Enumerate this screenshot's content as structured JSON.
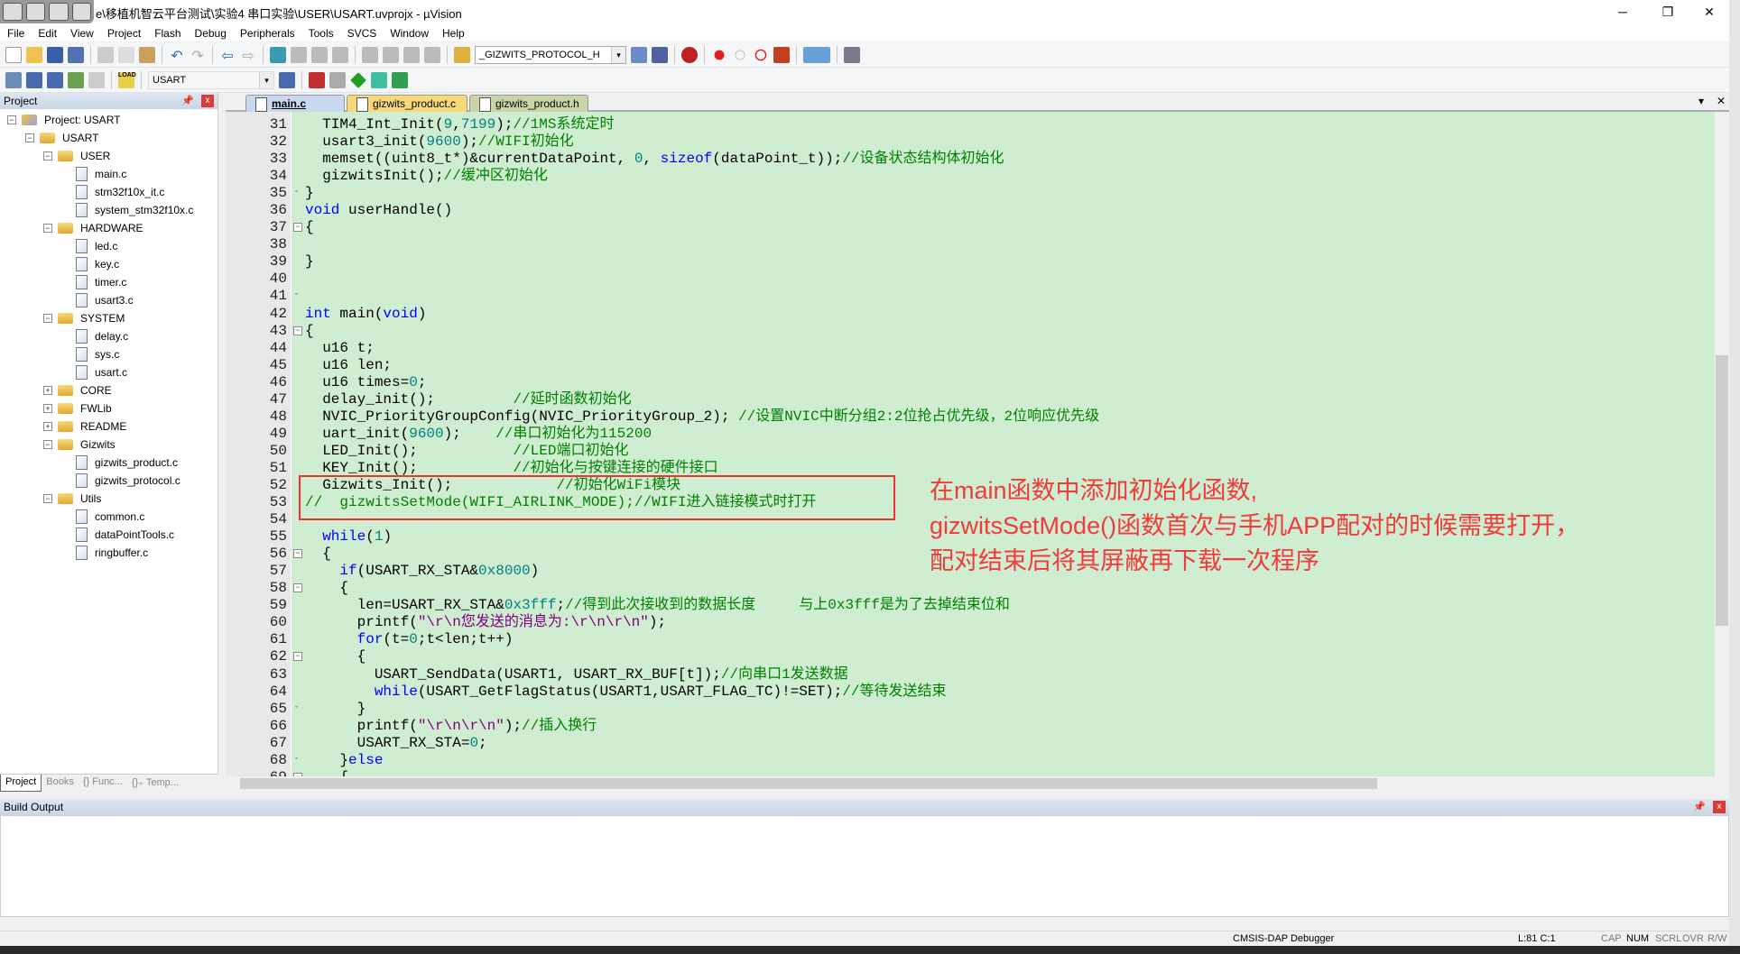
{
  "window": {
    "title": "e\\移植机智云平台测试\\实验4 串口实验\\USER\\USART.uvprojx - µVision",
    "minimize": "─",
    "maximize": "❐",
    "close": "✕"
  },
  "menu": [
    "File",
    "Edit",
    "View",
    "Project",
    "Flash",
    "Debug",
    "Peripherals",
    "Tools",
    "SVCS",
    "Window",
    "Help"
  ],
  "toolbar1": {
    "find_combo": "_GIZWITS_PROTOCOL_H"
  },
  "toolbar2": {
    "target_combo": "USART",
    "load_label": "LOAD"
  },
  "project_panel": {
    "title": "Project",
    "pin": "ᵖ",
    "close": "x",
    "tree": [
      {
        "label": "Project: USART",
        "level": 0,
        "type": "project",
        "exp": "−"
      },
      {
        "label": "USART",
        "level": 1,
        "type": "folder",
        "exp": "−"
      },
      {
        "label": "USER",
        "level": 2,
        "type": "folder",
        "exp": "−"
      },
      {
        "label": "main.c",
        "level": 3,
        "type": "file"
      },
      {
        "label": "stm32f10x_it.c",
        "level": 3,
        "type": "file"
      },
      {
        "label": "system_stm32f10x.c",
        "level": 3,
        "type": "file"
      },
      {
        "label": "HARDWARE",
        "level": 2,
        "type": "folder",
        "exp": "−"
      },
      {
        "label": "led.c",
        "level": 3,
        "type": "file"
      },
      {
        "label": "key.c",
        "level": 3,
        "type": "file"
      },
      {
        "label": "timer.c",
        "level": 3,
        "type": "file"
      },
      {
        "label": "usart3.c",
        "level": 3,
        "type": "file"
      },
      {
        "label": "SYSTEM",
        "level": 2,
        "type": "folder",
        "exp": "−"
      },
      {
        "label": "delay.c",
        "level": 3,
        "type": "file"
      },
      {
        "label": "sys.c",
        "level": 3,
        "type": "file"
      },
      {
        "label": "usart.c",
        "level": 3,
        "type": "file"
      },
      {
        "label": "CORE",
        "level": 2,
        "type": "folder",
        "exp": "+"
      },
      {
        "label": "FWLib",
        "level": 2,
        "type": "folder",
        "exp": "+"
      },
      {
        "label": "README",
        "level": 2,
        "type": "folder",
        "exp": "+"
      },
      {
        "label": "Gizwits",
        "level": 2,
        "type": "folder",
        "exp": "−"
      },
      {
        "label": "gizwits_product.c",
        "level": 3,
        "type": "file"
      },
      {
        "label": "gizwits_protocol.c",
        "level": 3,
        "type": "file"
      },
      {
        "label": "Utils",
        "level": 2,
        "type": "folder",
        "exp": "−"
      },
      {
        "label": "common.c",
        "level": 3,
        "type": "file"
      },
      {
        "label": "dataPointTools.c",
        "level": 3,
        "type": "file"
      },
      {
        "label": "ringbuffer.c",
        "level": 3,
        "type": "file"
      }
    ],
    "tabs": [
      {
        "label": "Project",
        "active": true
      },
      {
        "label": "Books"
      },
      {
        "label": "{} Func..."
      },
      {
        "label": "{}₊ Temp..."
      }
    ]
  },
  "editor": {
    "tabs": [
      {
        "label": "main.c",
        "active": true,
        "color": "#c8d8ee"
      },
      {
        "label": "gizwits_product.c",
        "color": "#f7d97a"
      },
      {
        "label": "gizwits_product.h",
        "color": "#c9d5a6"
      }
    ],
    "tab_menu": "▾",
    "tab_close": "✕",
    "background": "#cfedd1",
    "folds": {
      "35": "end",
      "37": "open",
      "39": "line",
      "41": "end",
      "43": "open",
      "56": "open",
      "58": "open",
      "62": "open",
      "65": "end",
      "68": "end",
      "69": "open"
    },
    "lines": [
      {
        "n": "31",
        "code": "  TIM4_Int_Init(9,7199);//1MS系统定时"
      },
      {
        "n": "32",
        "code": "  usart3_init(9600);//WIFI初始化"
      },
      {
        "n": "33",
        "code": "  memset((uint8_t*)&currentDataPoint, 0, sizeof(dataPoint_t));//设备状态结构体初始化"
      },
      {
        "n": "34",
        "code": "  gizwitsInit();//缓冲区初始化"
      },
      {
        "n": "35",
        "code": "}"
      },
      {
        "n": "36",
        "code": "void userHandle()"
      },
      {
        "n": "37",
        "code": "{"
      },
      {
        "n": "38",
        "code": ""
      },
      {
        "n": "39",
        "code": "}"
      },
      {
        "n": "40",
        "code": ""
      },
      {
        "n": "41",
        "code": ""
      },
      {
        "n": "42",
        "code": "int main(void)"
      },
      {
        "n": "43",
        "code": "{"
      },
      {
        "n": "44",
        "code": "  u16 t;"
      },
      {
        "n": "45",
        "code": "  u16 len;"
      },
      {
        "n": "46",
        "code": "  u16 times=0;"
      },
      {
        "n": "47",
        "code": "  delay_init();         //延时函数初始化"
      },
      {
        "n": "48",
        "code": "  NVIC_PriorityGroupConfig(NVIC_PriorityGroup_2); //设置NVIC中断分组2:2位抢占优先级，2位响应优先级"
      },
      {
        "n": "49",
        "code": "  uart_init(9600);    //串口初始化为115200"
      },
      {
        "n": "50",
        "code": "  LED_Init();           //LED端口初始化"
      },
      {
        "n": "51",
        "code": "  KEY_Init();           //初始化与按键连接的硬件接口"
      },
      {
        "n": "52",
        "code": "  Gizwits_Init();            //初始化WiFi模块"
      },
      {
        "n": "53",
        "code": "//  gizwitsSetMode(WIFI_AIRLINK_MODE);//WIFI进入链接模式时打开"
      },
      {
        "n": "54",
        "code": ""
      },
      {
        "n": "55",
        "code": "  while(1)"
      },
      {
        "n": "56",
        "code": "  {"
      },
      {
        "n": "57",
        "code": "    if(USART_RX_STA&0x8000)"
      },
      {
        "n": "58",
        "code": "    {"
      },
      {
        "n": "59",
        "code": "      len=USART_RX_STA&0x3fff;//得到此次接收到的数据长度     与上0x3fff是为了去掉结束位和"
      },
      {
        "n": "60",
        "code": "      printf(\"\\r\\n您发送的消息为:\\r\\n\\r\\n\");"
      },
      {
        "n": "61",
        "code": "      for(t=0;t<len;t++)"
      },
      {
        "n": "62",
        "code": "      {"
      },
      {
        "n": "63",
        "code": "        USART_SendData(USART1, USART_RX_BUF[t]);//向串口1发送数据"
      },
      {
        "n": "64",
        "code": "        while(USART_GetFlagStatus(USART1,USART_FLAG_TC)!=SET);//等待发送结束"
      },
      {
        "n": "65",
        "code": "      }"
      },
      {
        "n": "66",
        "code": "      printf(\"\\r\\n\\r\\n\");//插入换行"
      },
      {
        "n": "67",
        "code": "      USART_RX_STA=0;"
      },
      {
        "n": "68",
        "code": "    }else"
      },
      {
        "n": "69",
        "code": "    {"
      }
    ]
  },
  "annotation": {
    "lines": [
      "在main函数中添加初始化函数,",
      "gizwitsSetMode()函数首次与手机APP配对的时候需要打开，",
      "配对结束后将其屏蔽再下载一次程序"
    ],
    "color": "#f23a3a"
  },
  "build_output": {
    "title": "Build Output",
    "pin": "ᵖ",
    "close": "x"
  },
  "status": {
    "debugger": "CMSIS-DAP Debugger",
    "position": "L:81 C:1",
    "cap": "CAP",
    "num": "NUM",
    "scrl": "SCRL",
    "ovr": "OVR",
    "rw": "R/W"
  }
}
